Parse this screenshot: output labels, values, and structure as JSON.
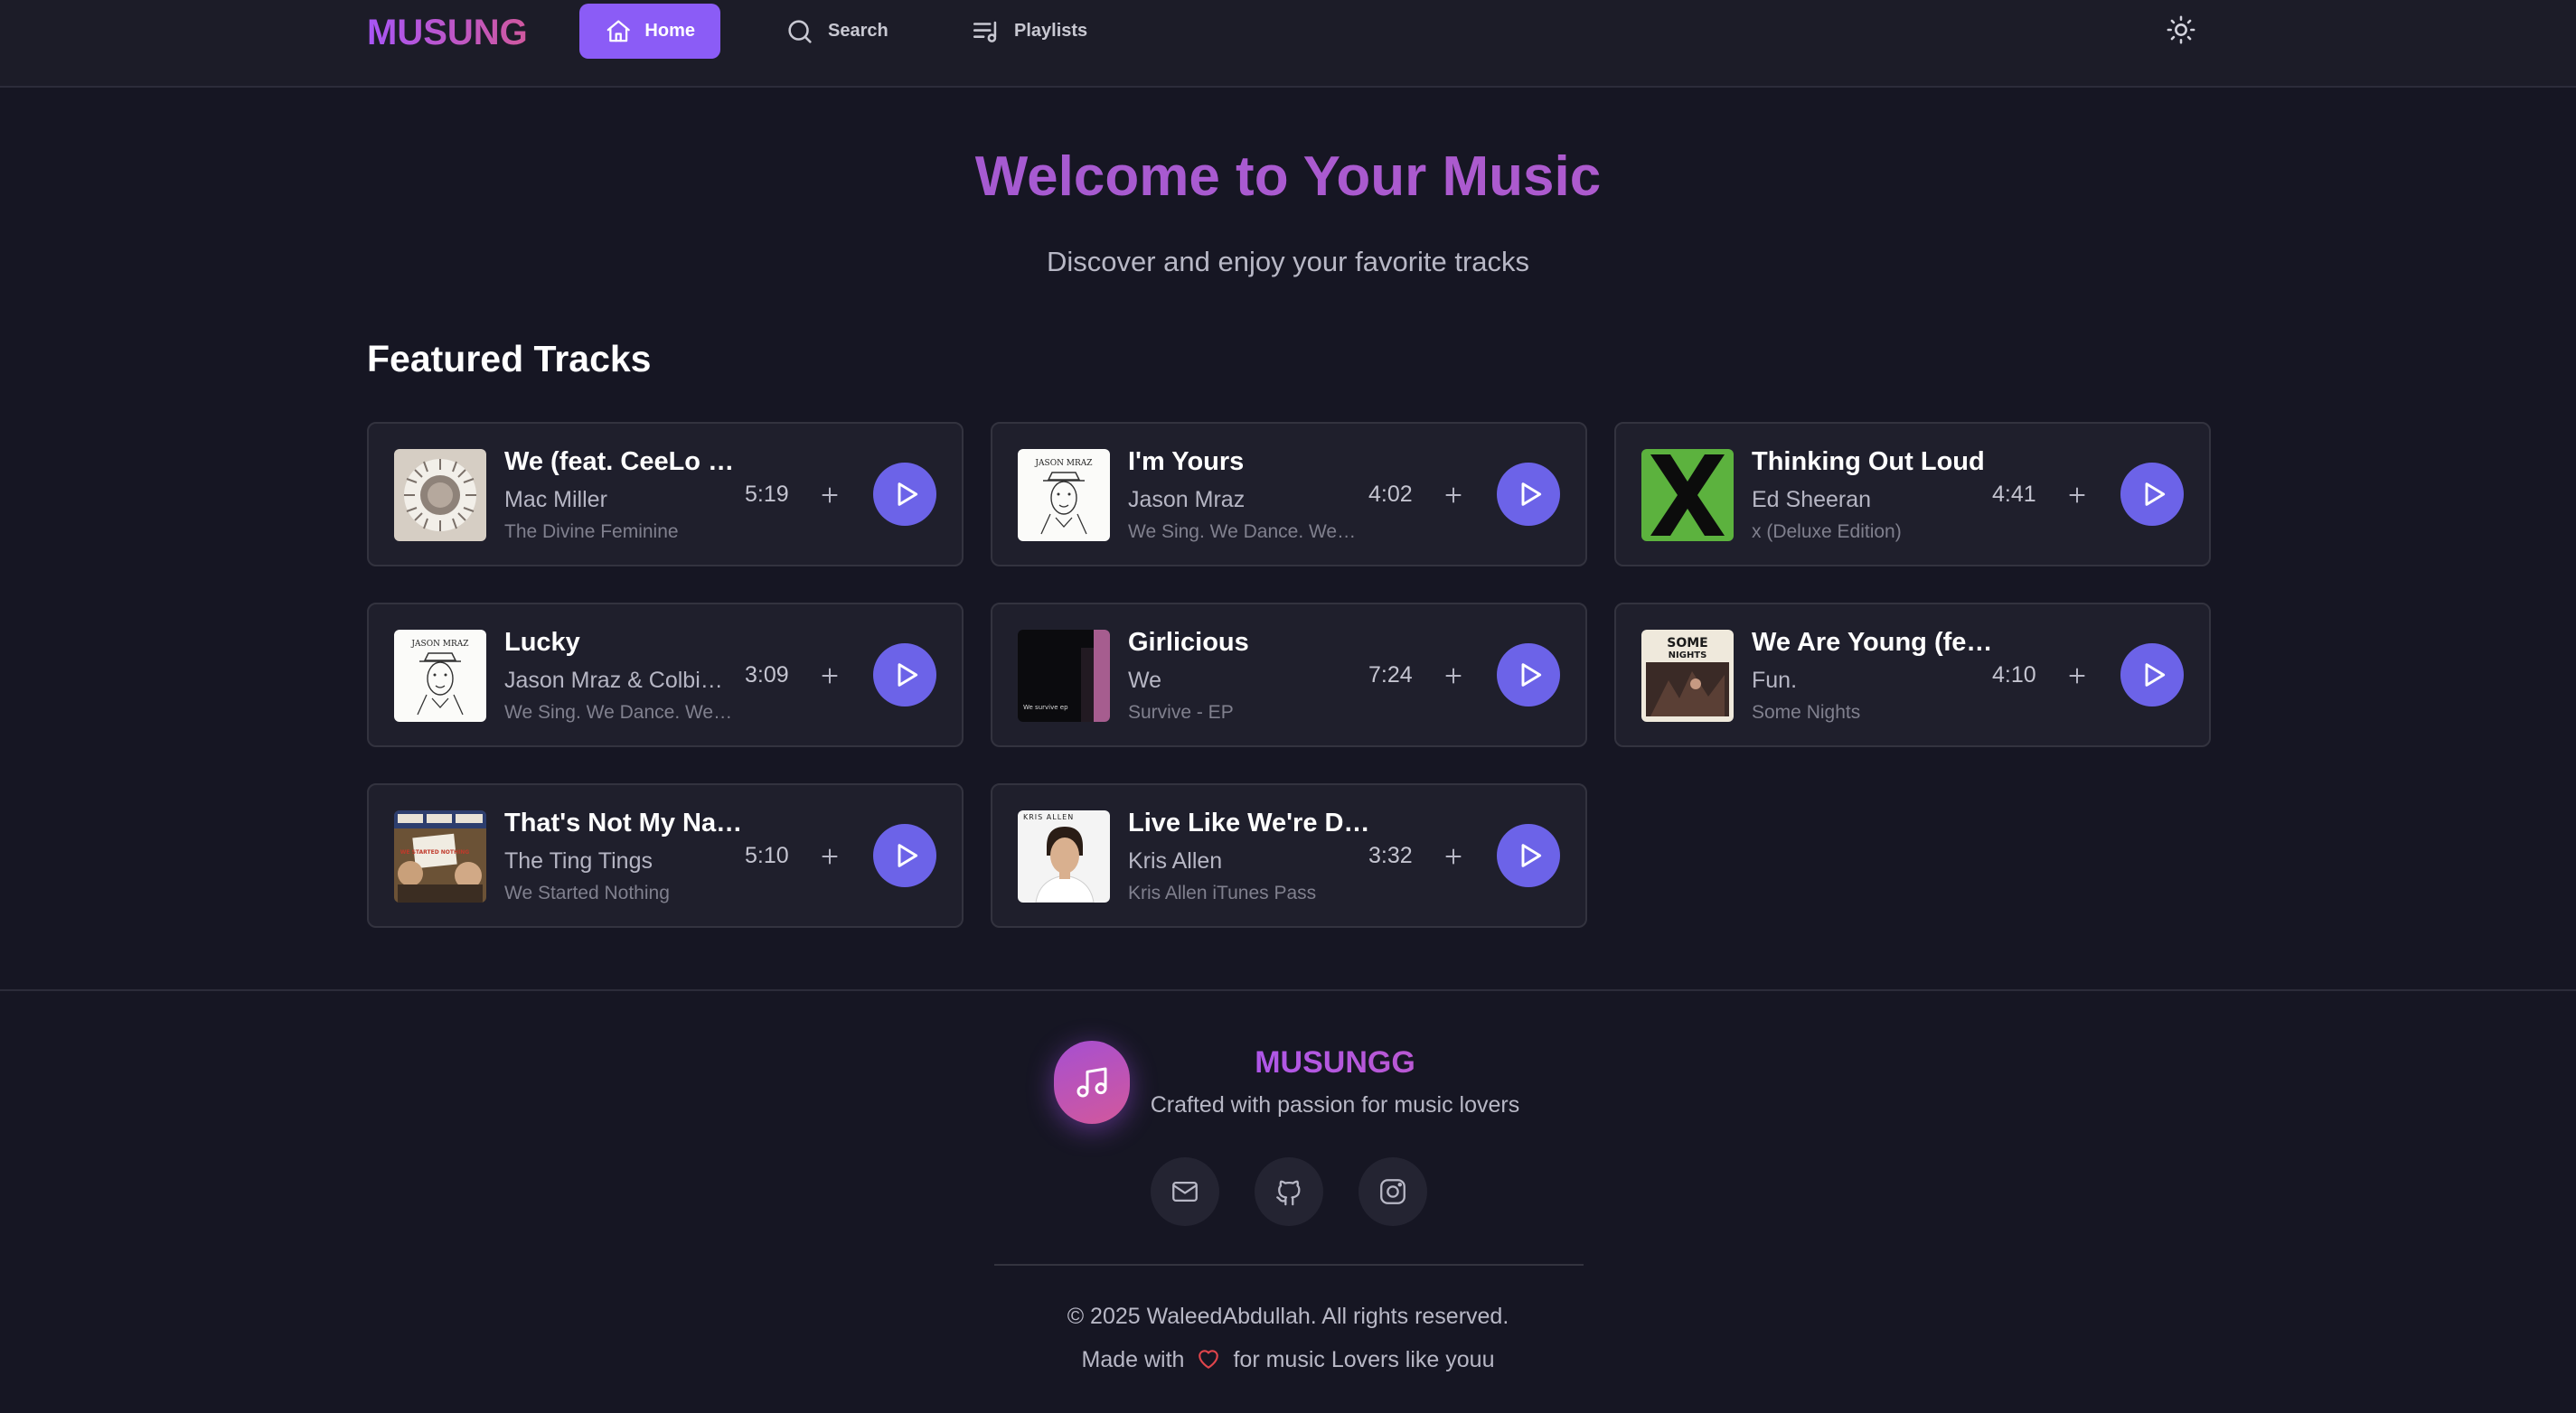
{
  "nav": {
    "logo": "MUSUNG",
    "items": [
      {
        "label": "Home",
        "icon": "home-icon",
        "active": true
      },
      {
        "label": "Search",
        "icon": "search-icon",
        "active": false
      },
      {
        "label": "Playlists",
        "icon": "playlist-icon",
        "active": false
      }
    ],
    "theme_icon": "sun-icon"
  },
  "hero": {
    "title": "Welcome to Your Music",
    "subtitle": "Discover and enjoy your favorite tracks"
  },
  "section_title": "Featured Tracks",
  "tracks": [
    {
      "title": "We (feat. CeeLo Green)",
      "artist": "Mac Miller",
      "album": "The Divine Feminine",
      "duration": "5:19"
    },
    {
      "title": "I'm Yours",
      "artist": "Jason Mraz",
      "album": "We Sing. We Dance. We Steal Things.",
      "duration": "4:02"
    },
    {
      "title": "Thinking Out Loud",
      "artist": "Ed Sheeran",
      "album": "x (Deluxe Edition)",
      "duration": "4:41"
    },
    {
      "title": "Lucky",
      "artist": "Jason Mraz & Colbie Caillat",
      "album": "We Sing. We Dance. We Steal Things.",
      "duration": "3:09"
    },
    {
      "title": "Girlicious",
      "artist": "We",
      "album": "Survive - EP",
      "duration": "7:24"
    },
    {
      "title": "We Are Young (feat. Janelle Monáe)",
      "artist": "Fun.",
      "album": "Some Nights",
      "duration": "4:10"
    },
    {
      "title": "That's Not My Name",
      "artist": "The Ting Tings",
      "album": "We Started Nothing",
      "duration": "5:10"
    },
    {
      "title": "Live Like We're Dying",
      "artist": "Kris Allen",
      "album": "Kris Allen iTunes Pass",
      "duration": "3:32"
    }
  ],
  "cover_texts": {
    "jason": "JASON MRAZ",
    "some": "SOME",
    "nights": "NIGHTS",
    "started": "WE STARTED NOTHING",
    "kris": "KRIS ALLEN",
    "girlicious": "We survive ep"
  },
  "footer": {
    "brand": "MUSUNGG",
    "tagline": "Crafted with passion for music lovers",
    "social": [
      "mail-icon",
      "github-icon",
      "instagram-icon"
    ],
    "copyright": "© 2025 WaleedAbdullah. All rights reserved.",
    "made_prefix": "Made with",
    "made_suffix": "for music Lovers like youu"
  },
  "colors": {
    "accent": "#8b5cf6",
    "play": "#6c63e8",
    "background": "#161623",
    "card": "#1f1f2c",
    "heart": "#e0454c"
  }
}
